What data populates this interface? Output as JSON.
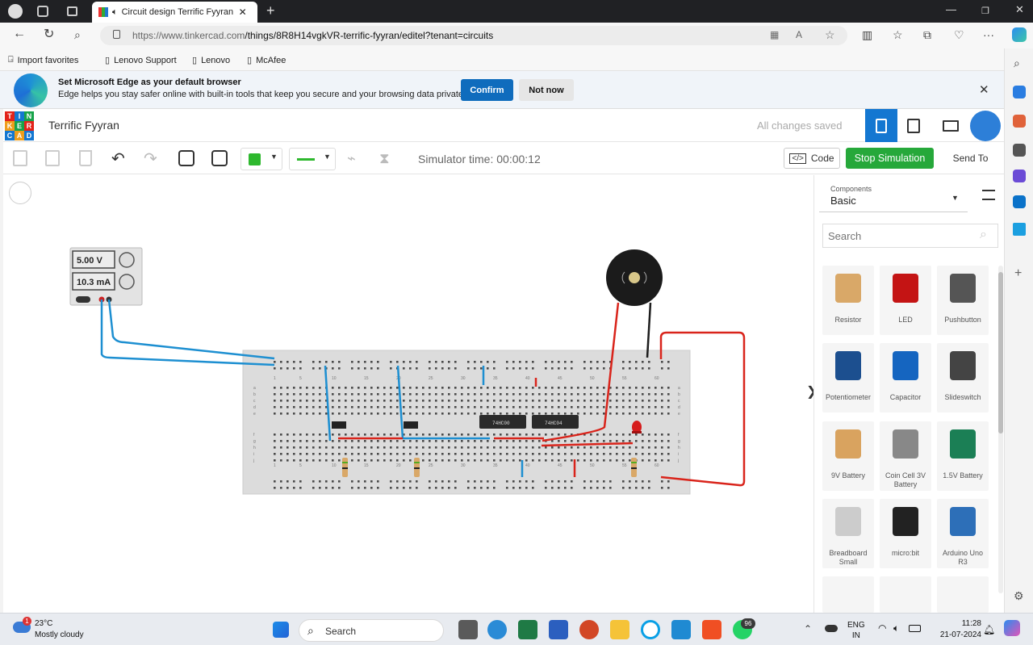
{
  "browser": {
    "tab_title": "Circuit design Terrific Fyyran",
    "url_host": "https://www.tinkercad.com",
    "url_path": "/things/8R8H14vgkVR-terrific-fyyran/editel?tenant=circuits",
    "favorites": [
      "Import favorites",
      "Lenovo Support",
      "Lenovo",
      "McAfee"
    ]
  },
  "banner": {
    "title": "Set Microsoft Edge as your default browser",
    "text": "Edge helps you stay safer online with built-in tools that keep you secure and your browsing data private",
    "confirm": "Confirm",
    "not_now": "Not now"
  },
  "app": {
    "logo": [
      "T",
      "I",
      "N",
      "K",
      "E",
      "R",
      "C",
      "A",
      "D"
    ],
    "project_title": "Terrific Fyyran",
    "save_status": "All changes saved",
    "sim_time": "Simulator time: 00:00:12",
    "code": "Code",
    "stop": "Stop Simulation",
    "send_to": "Send To"
  },
  "power_supply": {
    "voltage": "5.00 V",
    "current": "10.3 mA"
  },
  "chips": [
    "74HC00",
    "74HC04"
  ],
  "breadboard": {
    "col_labels": [
      "1",
      "5",
      "10",
      "15",
      "20",
      "25",
      "30",
      "35",
      "40",
      "45",
      "50",
      "55",
      "60"
    ],
    "row_labels": [
      "j",
      "i",
      "h",
      "g",
      "f",
      "e",
      "d",
      "c",
      "b",
      "a"
    ]
  },
  "panel": {
    "label": "Components",
    "selected": "Basic",
    "search_placeholder": "Search",
    "components": [
      "Resistor",
      "LED",
      "Pushbutton",
      "Potentiometer",
      "Capacitor",
      "Slideswitch",
      "9V Battery",
      "Coin Cell 3V Battery",
      "1.5V Battery",
      "Breadboard Small",
      "micro:bit",
      "Arduino Uno R3"
    ]
  },
  "taskbar": {
    "temp": "23°C",
    "weather": "Mostly cloudy",
    "weather_badge": "1",
    "search": "Search",
    "lang1": "ENG",
    "lang2": "IN",
    "time": "11:28",
    "date": "21-07-2024",
    "whatsapp_badge": "96"
  },
  "colors": {
    "accent_blue": "#0d6fb8",
    "tinkercad_green": "#26a83a",
    "wire_red": "#d9241b",
    "wire_blue": "#1d8fd1"
  }
}
